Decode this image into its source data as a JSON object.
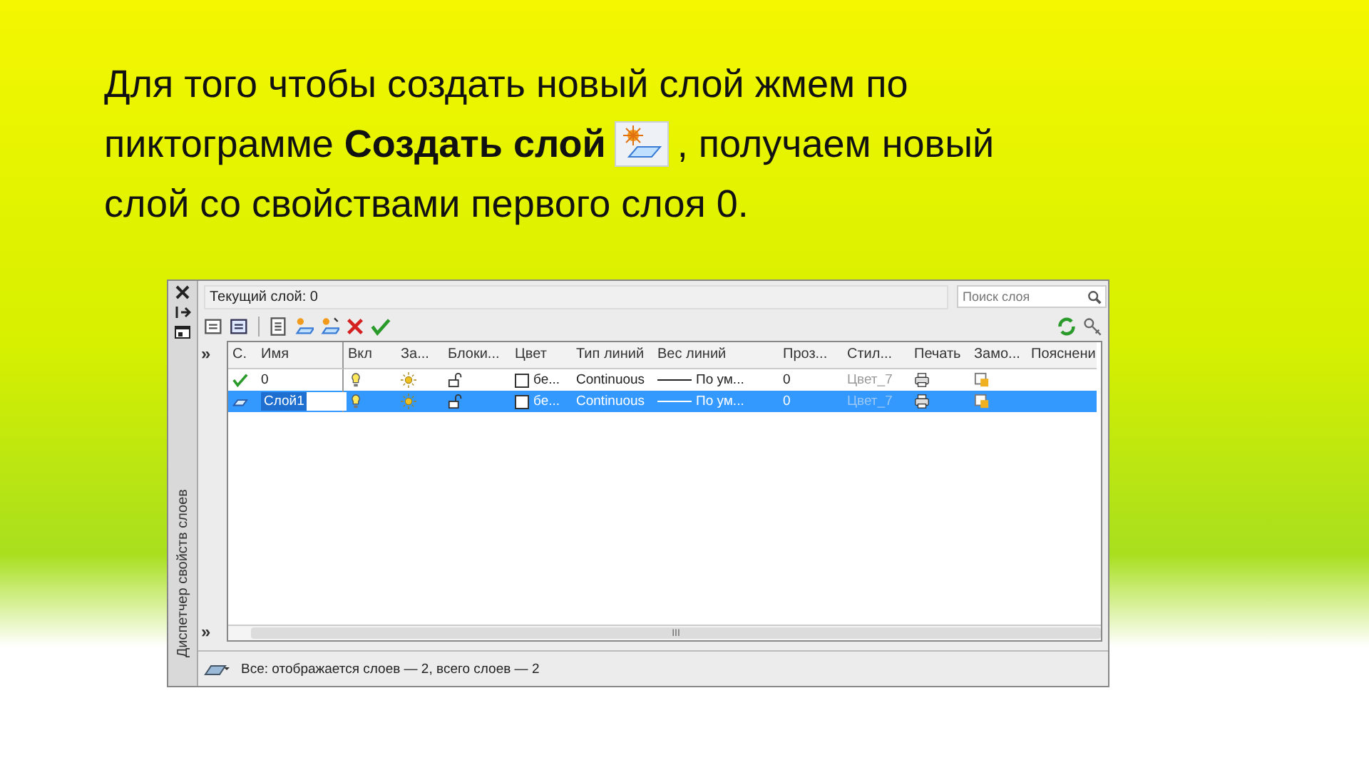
{
  "slide": {
    "line_1": "Для того чтобы создать новый слой жмем по",
    "line_2_before": "пиктограмме **Создать слой**",
    "line_2_after": ", получаем новый",
    "line_3": "слой со свойствами первого слоя 0."
  },
  "palette": {
    "side_title": "Диспетчер свойств слоев",
    "current_layer": "Текущий слой: 0",
    "search": {
      "placeholder": "Поиск слоя"
    },
    "tree_toggles": [
      "»",
      "»"
    ],
    "columns": [
      "С.",
      "Имя",
      "Вкл",
      "За...",
      "Блоки...",
      "Цвет",
      "Тип линий",
      "Вес линий",
      "Проз...",
      "Стил...",
      "Печать",
      "Замо...",
      "Пояснени"
    ],
    "rows": [
      {
        "current": true,
        "name": "0",
        "selected": false,
        "editing": false,
        "on": true,
        "frozen": false,
        "locked": false,
        "color_name": "бе...",
        "linetype": "Continuous",
        "lineweight": "По ум...",
        "transparency": "0",
        "plot_style": "Цвет_7",
        "plot": true
      },
      {
        "current": false,
        "name": "Слой1",
        "selected": true,
        "editing": true,
        "on": true,
        "frozen": false,
        "locked": false,
        "color_name": "бе...",
        "linetype": "Continuous",
        "lineweight": "По ум...",
        "transparency": "0",
        "plot_style": "Цвет_7",
        "plot": true
      }
    ],
    "scroll_mark": "III",
    "status_text": "Все: отображается слоев — 2, всего слоев — 2"
  }
}
